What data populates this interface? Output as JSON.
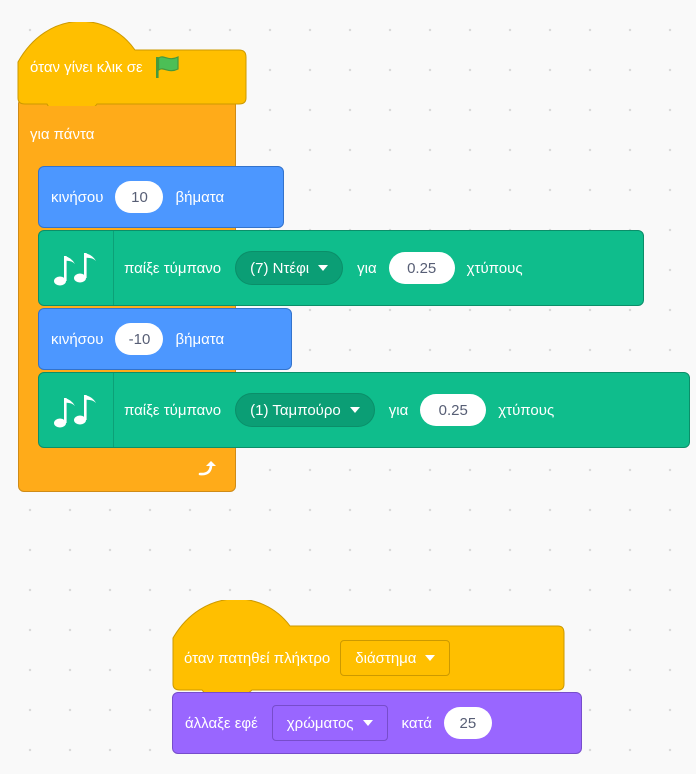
{
  "script1": {
    "hat_label": "όταν γίνει κλικ σε",
    "hat_icon": "green-flag-icon",
    "forever_label": "για πάντα",
    "loop_icon": "loop-arrow-icon",
    "move1": {
      "label": "κινήσου",
      "value": "10",
      "unit": "βήματα"
    },
    "drum1": {
      "label": "παίξε τύμπανο",
      "drum": "(7) Ντέφι",
      "for": "για",
      "beats": "0.25",
      "unit": "χτύπους",
      "icon": "music-notes-icon"
    },
    "move2": {
      "label": "κινήσου",
      "value": "-10",
      "unit": "βήματα"
    },
    "drum2": {
      "label": "παίξε τύμπανο",
      "drum": "(1) Ταμπούρο",
      "for": "για",
      "beats": "0.25",
      "unit": "χτύπους",
      "icon": "music-notes-icon"
    }
  },
  "script2": {
    "hat_label": "όταν πατηθεί πλήκτρο",
    "key": "διάστημα",
    "change_label": "άλλαξε εφέ",
    "effect": "χρώματος",
    "by_label": "κατά",
    "amount": "25"
  },
  "colors": {
    "events": "#ffbf00",
    "control": "#ffab19",
    "motion": "#4c97ff",
    "music": "#0fbd8c",
    "looks": "#9966ff"
  }
}
